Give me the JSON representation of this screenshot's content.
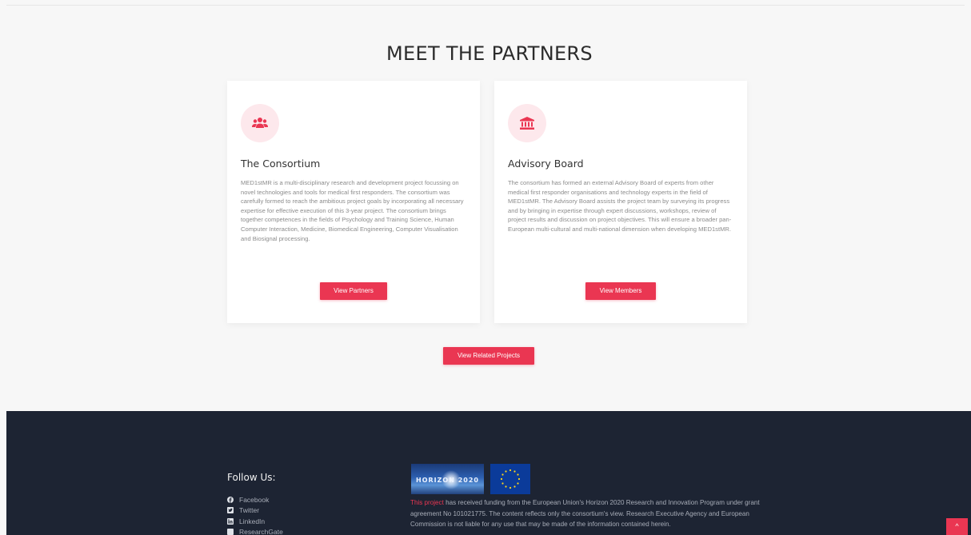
{
  "section": {
    "title": "MEET THE PARTNERS"
  },
  "cards": [
    {
      "icon": "users-icon",
      "title": "The Consortium",
      "text": "MED1stMR is a multi-disciplinary research and development project focussing on novel technologies and tools for medical first responders. The consortium was carefully formed to reach the ambitious project goals by incorporating all necessary expertise for effective execution of this 3-year project. The consortium brings together competences in the fields of Psychology and Training Science, Human Computer Interaction, Medicine, Biomedical Engineering, Computer Visualisation and Biosignal processing.",
      "button_label": "View Partners"
    },
    {
      "icon": "institution-icon",
      "title": "Advisory Board",
      "text": "The consortium has formed an external Advisory Board of experts from other medical first responder organisations and technology experts in the field of MED1stMR. The Advisory Board assists the project team by surveying its progress and by bringing in expertise through expert discussions, workshops, review of project results and discussion on project objectives. This will ensure a broader pan-European multi-cultural and multi-national dimension when developing MED1stMR.",
      "button_label": "View Members"
    }
  ],
  "related_button_label": "View Related Projects",
  "footer": {
    "follow_title": "Follow Us:",
    "social": [
      {
        "label": "Facebook",
        "icon": "facebook-icon"
      },
      {
        "label": "Twitter",
        "icon": "twitter-icon"
      },
      {
        "label": "LinkedIn",
        "icon": "linkedin-icon"
      },
      {
        "label": "ResearchGate",
        "icon": "researchgate-icon"
      }
    ],
    "horizon_logo_text": "HORIZON 2020",
    "funding_link": "This project",
    "funding_text": " has received funding from the European Union's Horizon 2020 Research and Innovation Program under grant agreement No 101021775. The content reflects only the consortium's view. Research Executive Agency and European Commission is not liable for any use that may be made of the information contained herein."
  },
  "scroll_top_symbol": "^",
  "colors": {
    "accent": "#ea3652",
    "footer_bg": "#1d2433",
    "icon_bg": "#fde8ec"
  }
}
